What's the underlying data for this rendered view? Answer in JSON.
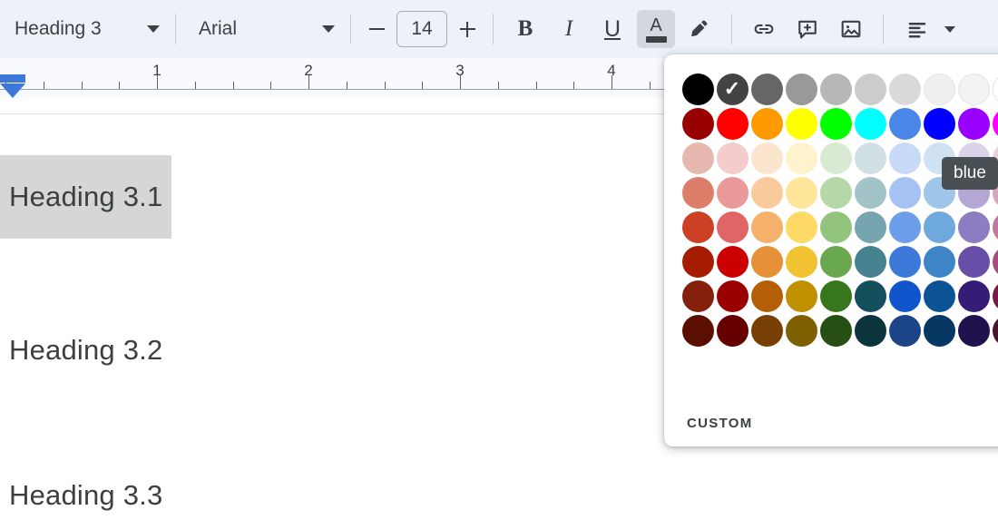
{
  "toolbar": {
    "paragraph_style": "Heading 3",
    "font_family": "Arial",
    "font_size": "14",
    "decrease_font_label": "−",
    "increase_font_label": "+",
    "bold_label": "B",
    "italic_label": "I",
    "underline_label": "U",
    "text_color_label": "A",
    "icons": {
      "style_caret": "chevron-down-icon",
      "font_caret": "chevron-down-icon",
      "highlight": "highlight-pen-icon",
      "link": "link-icon",
      "comment": "add-comment-icon",
      "image": "insert-image-icon",
      "align": "align-left-icon",
      "align_caret": "chevron-down-icon"
    }
  },
  "ruler": {
    "numbers": [
      "1",
      "2",
      "3",
      "4"
    ],
    "number_positions": [
      173,
      340,
      507,
      674
    ],
    "tick_spacing": 41.75,
    "indent_marker": "left-indent-marker"
  },
  "document": {
    "headings": [
      {
        "text": "Heading 3.1",
        "selected": true
      },
      {
        "text": "Heading 3.2",
        "selected": false
      },
      {
        "text": "Heading 3.3",
        "selected": false
      }
    ],
    "selection_color": "#d6d6d6",
    "text_color": "#3c4043"
  },
  "color_picker": {
    "custom_label": "CUSTOM",
    "add_custom_icon": "plus-circle-icon",
    "eyedropper_icon": "eyedropper-icon",
    "selected_color": "#434343",
    "selected_row": 0,
    "selected_col": 1,
    "tooltip": "blue",
    "columns": 10,
    "rows": 8,
    "swatches": [
      [
        "#000000",
        "#434343",
        "#666666",
        "#999999",
        "#b7b7b7",
        "#cccccc",
        "#d9d9d9",
        "#efefef",
        "#f3f3f3",
        "#ffffff"
      ],
      [
        "#980000",
        "#ff0000",
        "#ff9900",
        "#ffff00",
        "#00ff00",
        "#00ffff",
        "#4a86e8",
        "#0000ff",
        "#9900ff",
        "#ff00ff"
      ],
      [
        "#e6b8af",
        "#f4cccc",
        "#fce5cd",
        "#fff2cc",
        "#d9ead3",
        "#d0e0e3",
        "#c9daf8",
        "#cfe2f3",
        "#d9d2e9",
        "#ead1dc"
      ],
      [
        "#dd7e6b",
        "#ea9999",
        "#f9cb9c",
        "#ffe599",
        "#b6d7a8",
        "#a2c4c9",
        "#a4c2f4",
        "#9fc5e8",
        "#b4a7d6",
        "#d5a6bd"
      ],
      [
        "#cc4125",
        "#e06666",
        "#f6b26b",
        "#ffd966",
        "#93c47d",
        "#76a5af",
        "#6d9eeb",
        "#6fa8dc",
        "#8e7cc3",
        "#c27ba0"
      ],
      [
        "#a61c00",
        "#cc0000",
        "#e69138",
        "#f1c232",
        "#6aa84f",
        "#45818e",
        "#3c78d8",
        "#3d85c6",
        "#674ea7",
        "#a64d79"
      ],
      [
        "#85200c",
        "#990000",
        "#b45f06",
        "#bf9000",
        "#38761d",
        "#134f5c",
        "#1155cc",
        "#0b5394",
        "#351c75",
        "#741b47"
      ],
      [
        "#5b0f00",
        "#660000",
        "#783f04",
        "#7f6000",
        "#274e13",
        "#0c343d",
        "#1c4587",
        "#073763",
        "#20124d",
        "#4c1130"
      ]
    ]
  }
}
